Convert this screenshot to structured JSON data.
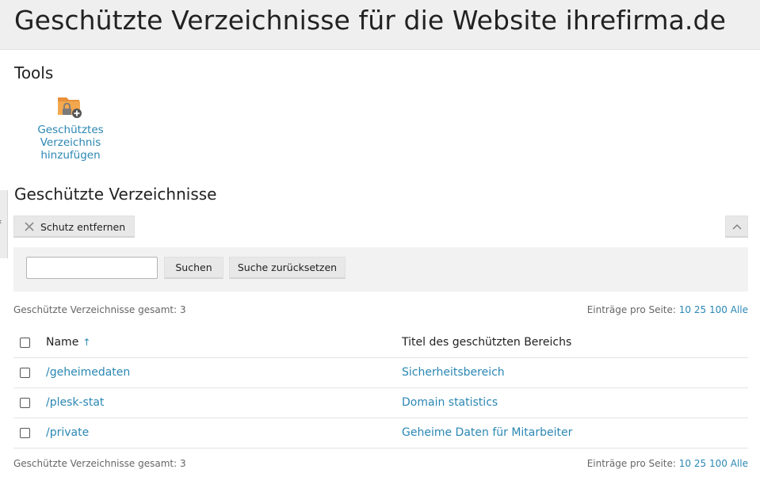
{
  "header": {
    "title": "Geschützte Verzeichnisse für die Website ihrefirma.de"
  },
  "tools": {
    "heading": "Tools",
    "items": [
      {
        "icon": "folder-lock-add-icon",
        "label_lines": [
          "Geschütztes",
          "Verzeichnis",
          "hinzufügen"
        ]
      }
    ]
  },
  "side_handle": {
    "glyph": "‹"
  },
  "list": {
    "heading": "Geschützte Verzeichnisse",
    "toolbar": {
      "remove_label": "Schutz entfernen",
      "remove_icon": "x-icon",
      "collapse_icon": "chevron-up-icon"
    },
    "search": {
      "value": "",
      "placeholder": "",
      "search_label": "Suchen",
      "reset_label": "Suche zurücksetzen"
    },
    "summary": {
      "total_text": "Geschützte Verzeichnisse gesamt: 3",
      "per_page_label": "Einträge pro Seite:",
      "per_page_options": [
        "10",
        "25",
        "100",
        "Alle"
      ]
    },
    "columns": {
      "name": "Name",
      "sort_indicator": "↑",
      "title": "Titel des geschützten Bereichs"
    },
    "rows": [
      {
        "name": "/geheimedaten",
        "title": "Sicherheitsbereich"
      },
      {
        "name": "/plesk-stat",
        "title": "Domain statistics"
      },
      {
        "name": "/private",
        "title": "Geheime Daten für Mitarbeiter"
      }
    ]
  },
  "colors": {
    "accent": "#2a87b3",
    "header_bg": "#efefef",
    "icon_orange": "#f0a24a"
  }
}
